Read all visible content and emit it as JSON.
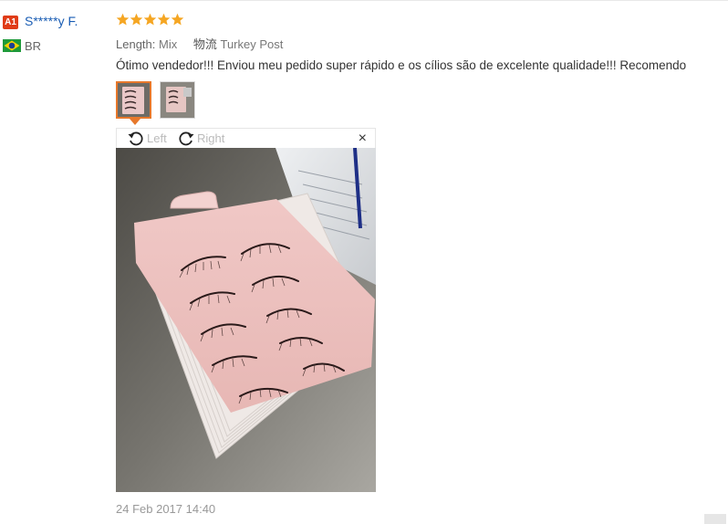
{
  "review": {
    "badge": "A1",
    "user_name": "S*****y F.",
    "country": "BR",
    "rating": 5,
    "length_label": "Length:",
    "length_value": "Mix",
    "shipping_label": "物流",
    "shipping_value": "Turkey Post",
    "text": "Ótimo vendedor!!! Enviou meu pedido super rápido e os cílios são de excelente qualidade!!! Recomendo",
    "date": "24 Feb 2017 14:40"
  },
  "viewer": {
    "rotate_left_label": "Left",
    "rotate_right_label": "Right",
    "close_label": "×"
  },
  "colors": {
    "star": "#f5a623",
    "link": "#1a5db4",
    "selected_border": "#e7782b",
    "badge": "#e03c18"
  }
}
